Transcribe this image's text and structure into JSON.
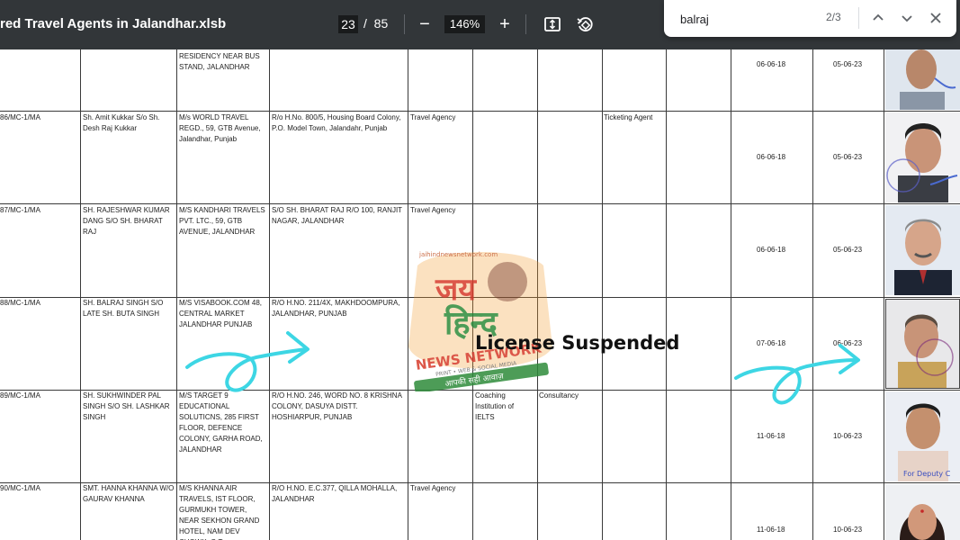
{
  "toolbar": {
    "doc_title": "red Travel Agents in Jalandhar.xlsb",
    "current_page": "23",
    "page_separator": "/",
    "total_pages": "85",
    "zoom": "146%",
    "zoom_out_glyph": "−",
    "zoom_in_glyph": "+",
    "fit_icon": "fit-page-icon",
    "rotate_icon": "rotate-icon"
  },
  "find": {
    "query": "balraj",
    "count": "2/3",
    "prev_glyph": "︿",
    "next_glyph": "﹀",
    "close_glyph": "✕"
  },
  "rows": [
    {
      "reg": "",
      "name": "",
      "firm": "RESIDENCY NEAR BUS STAND, JALANDHAR",
      "address": "",
      "type": "",
      "coaching": "",
      "consultancy": "",
      "ticketing": "",
      "issue_date": "06-06-18",
      "expiry_date": "05-06-23"
    },
    {
      "reg": "86/MC-1/MA",
      "name": "Sh. Amit Kukkar S/o Sh. Desh Raj Kukkar",
      "firm": "M/s WORLD TRAVEL REGD., 59, GTB Avenue, Jalandhar, Punjab",
      "address": "R/o H.No. 800/5, Housing Board Colony, P.O. Model Town, Jalandahr, Punjab",
      "type": "Travel Agency",
      "coaching": "",
      "consultancy": "",
      "ticketing": "Ticketing Agent",
      "issue_date": "06-06-18",
      "expiry_date": "05-06-23"
    },
    {
      "reg": "87/MC-1/MA",
      "name": "SH. RAJESHWAR KUMAR DANG S/O SH. BHARAT RAJ",
      "firm": "M/S KANDHARI TRAVELS PVT. LTC., 59, GTB AVENUE, JALANDHAR",
      "address": "S/O SH. BHARAT RAJ R/O 100, RANJIT NAGAR, JALANDHAR",
      "type": "Travel Agency",
      "coaching": "",
      "consultancy": "",
      "ticketing": "",
      "issue_date": "06-06-18",
      "expiry_date": "05-06-23"
    },
    {
      "reg": "88/MC-1/MA",
      "name": "SH. BALRAJ SINGH S/O LATE SH. BUTA SINGH",
      "firm": "M/S VISABOOK.COM 48, CENTRAL MARKET JALANDHAR PUNJAB",
      "address": "R/O H.NO. 211/4X, MAKHDOOMPURA, JALANDHAR, PUNJAB",
      "type": "",
      "coaching": "",
      "consultancy": "",
      "ticketing": "",
      "issue_date": "07-06-18",
      "expiry_date": "06-06-23"
    },
    {
      "reg": "89/MC-1/MA",
      "name": "SH. SUKHWINDER PAL SINGH S/O SH. LASHKAR SINGH",
      "firm": "M/S TARGET 9 EDUCATIONAL SOLUTICNS, 285 FIRST FLOOR, DEFENCE COLONY, GARHA ROAD, JALANDHAR",
      "address": "R/O H.NO. 246, WORD NO. 8 KRISHNA COLONY, DASUYA DISTT. HOSHIARPUR, PUNJAB",
      "type": "",
      "coaching": "Coaching Institution of IELTS",
      "consultancy": "Consultancy",
      "ticketing": "",
      "issue_date": "11-06-18",
      "expiry_date": "10-06-23"
    },
    {
      "reg": "90/MC-1/MA",
      "name": "SMT. HANNA KHANNA W/O GAURAV KHANNA",
      "firm": "M/S KHANNA AIR TRAVELS, IST FLOOR, GURMUKH TOWER, NEAR SEKHON GRAND HOTEL, NAM DEV CHOWK, G.T.",
      "address": "R/O H.NO. E.C.377, QILLA MOHALLA, JALANDHAR",
      "type": "Travel Agency",
      "coaching": "",
      "consultancy": "",
      "ticketing": "",
      "issue_date": "11-06-18",
      "expiry_date": "10-06-23"
    }
  ],
  "overlay": {
    "suspended_label": "License Suspended",
    "watermark_line1": "जय",
    "watermark_line2": "हिन्द",
    "watermark_network": "NEWS NETWORK",
    "watermark_media": "PRINT • WEB & SOCIAL MEDIA",
    "watermark_slogan": "आपकी सही आवाज़",
    "watermark_url": "jaihindnewsnetwork.com",
    "photo_stamp_text": "For Deputy C"
  },
  "colors": {
    "toolbar_bg": "#323639",
    "arrow": "#3dd6e4",
    "watermark_red": "#d63a2a",
    "watermark_green": "#2e8b3a",
    "watermark_orange": "#f39a2b"
  }
}
